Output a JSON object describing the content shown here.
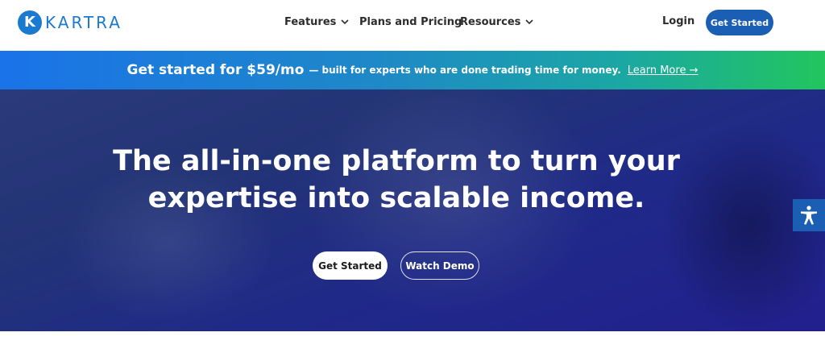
{
  "brand": {
    "logo_letter": "K",
    "name": "KARTRA",
    "color": "#1a79d0"
  },
  "nav": {
    "features": "Features",
    "pricing": "Plans and Pricing",
    "resources": "Resources",
    "login": "Login",
    "get_started": "Get Started"
  },
  "banner": {
    "strong": "Get started for $59/mo",
    "rest": "— built for experts who are done trading time for money.",
    "link": "Learn More →"
  },
  "hero": {
    "title_line1": "The all-in-one platform to turn your",
    "title_line2": "expertise into scalable income.",
    "primary_button": "Get Started",
    "secondary_button": "Watch Demo"
  },
  "icons": {
    "accessibility": "accessibility-icon",
    "dropdown": "chevron-down-icon"
  },
  "colors": {
    "accent": "#1a5fb4",
    "banner_start": "#1a73e8",
    "banner_end": "#22c55e",
    "hero_bg": "#1f2a88"
  }
}
